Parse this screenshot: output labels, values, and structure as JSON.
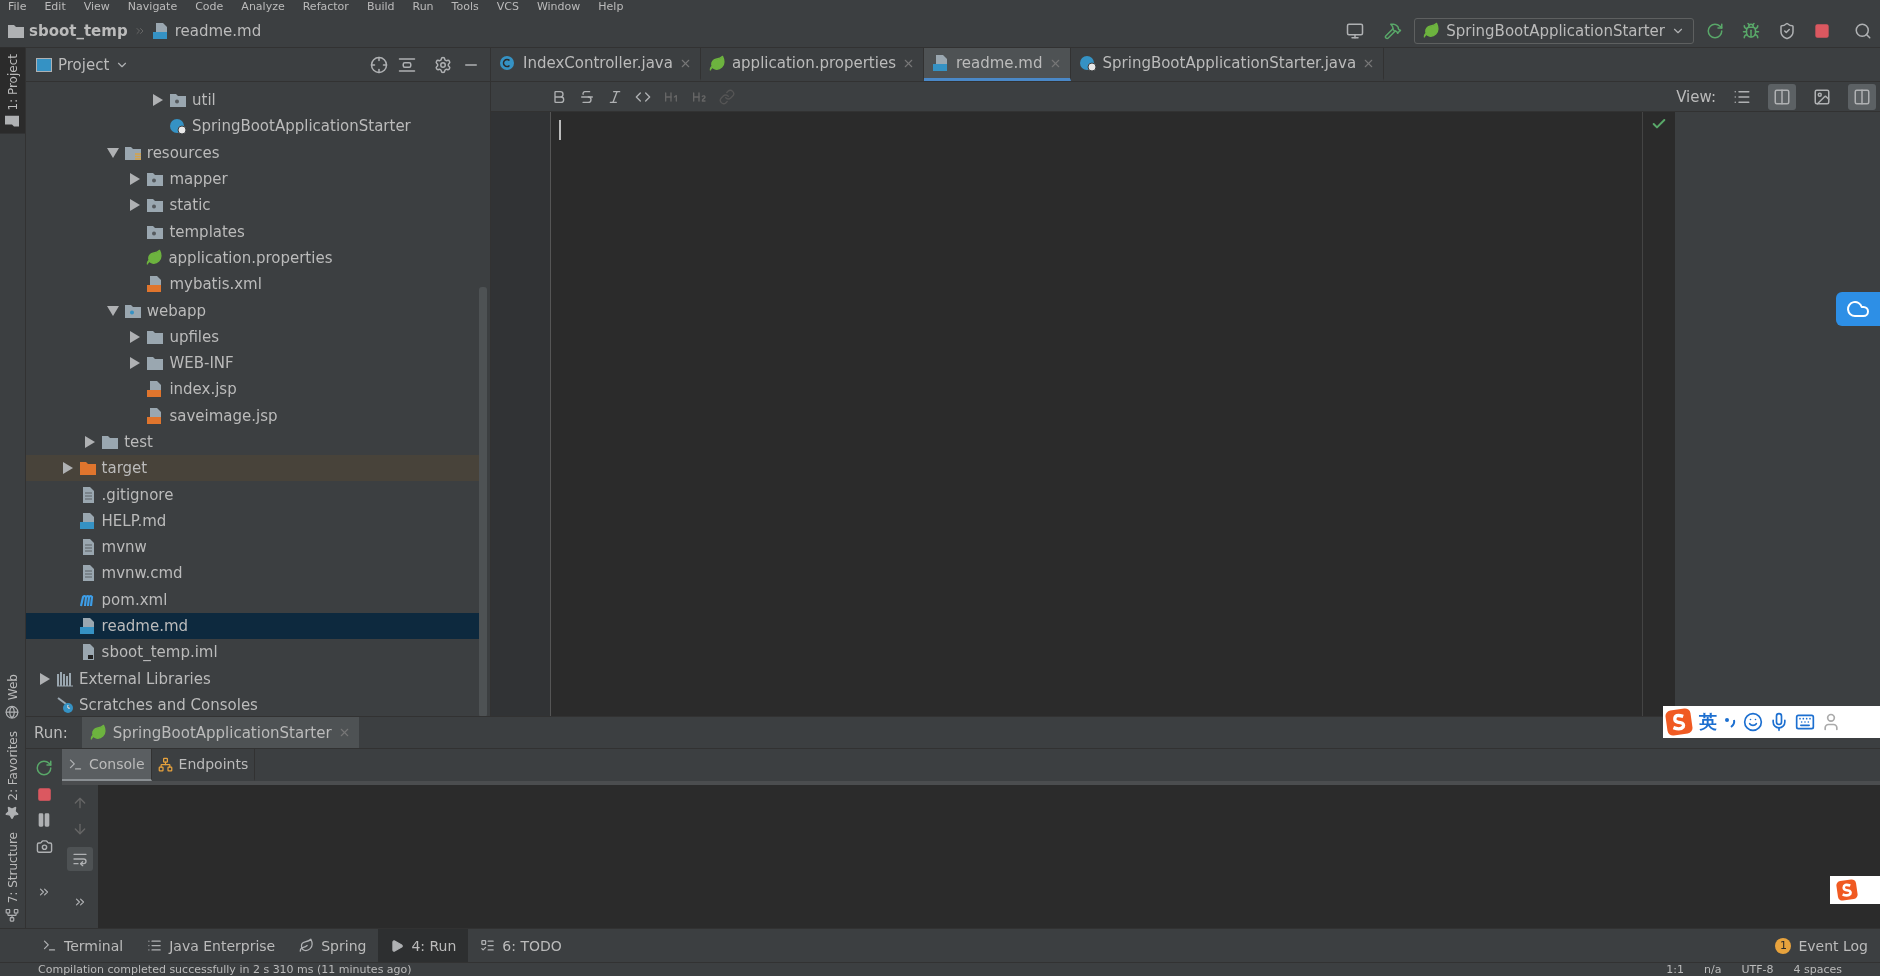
{
  "menu": [
    "File",
    "Edit",
    "View",
    "Navigate",
    "Code",
    "Analyze",
    "Refactor",
    "Build",
    "Run",
    "Tools",
    "VCS",
    "Window",
    "Help"
  ],
  "breadcrumb": [
    {
      "label": "sboot_temp",
      "kind": "project"
    },
    {
      "label": "readme.md",
      "kind": "md"
    }
  ],
  "run_config": {
    "label": "SpringBootApplicationStarter"
  },
  "side_tabs": [
    {
      "label": "1: Project",
      "selected": true,
      "kind": "project"
    },
    {
      "label": "Web",
      "selected": false,
      "kind": "web"
    },
    {
      "label": "2: Favorites",
      "selected": false,
      "kind": "favorites"
    },
    {
      "label": "7: Structure",
      "selected": false,
      "kind": "structure"
    }
  ],
  "project_panel": {
    "title": "Project"
  },
  "tree": [
    {
      "children": [
        {
          "children": [
            {
              "children": [
                {
                  "children": [
                    {
                      "children": [
                        {
                          "label": "util",
                          "kind": "package",
                          "expanded": false,
                          "selected": false
                        },
                        {
                          "label": "SpringBootApplicationStarter",
                          "kind": "spring-class",
                          "selected": false
                        }
                      ]
                    }
                  ]
                },
                {
                  "label": "resources",
                  "kind": "resource-folder",
                  "expanded": true,
                  "selected": false,
                  "children": [
                    {
                      "label": "mapper",
                      "kind": "package",
                      "expanded": false,
                      "selected": false
                    },
                    {
                      "label": "static",
                      "kind": "package",
                      "expanded": false,
                      "selected": false
                    },
                    {
                      "label": "templates",
                      "kind": "package",
                      "selected": false
                    },
                    {
                      "label": "application.properties",
                      "kind": "spring",
                      "selected": false
                    },
                    {
                      "label": "mybatis.xml",
                      "kind": "xml",
                      "selected": false
                    }
                  ]
                },
                {
                  "label": "webapp",
                  "kind": "web-folder",
                  "expanded": true,
                  "selected": false,
                  "children": [
                    {
                      "label": "upfiles",
                      "kind": "folder",
                      "expanded": false,
                      "selected": false
                    },
                    {
                      "label": "WEB-INF",
                      "kind": "folder",
                      "expanded": false,
                      "selected": false
                    },
                    {
                      "label": "index.jsp",
                      "kind": "jsp",
                      "selected": false
                    },
                    {
                      "label": "saveimage.jsp",
                      "kind": "jsp",
                      "selected": false
                    }
                  ]
                }
              ]
            },
            {
              "label": "test",
              "kind": "folder",
              "expanded": false,
              "selected": false
            }
          ]
        },
        {
          "label": "target",
          "kind": "excluded-folder",
          "expanded": false,
          "selected": false
        },
        {
          "label": ".gitignore",
          "kind": "text",
          "selected": false
        },
        {
          "label": "HELP.md",
          "kind": "md",
          "selected": false
        },
        {
          "label": "mvnw",
          "kind": "text",
          "selected": false
        },
        {
          "label": "mvnw.cmd",
          "kind": "text",
          "selected": false
        },
        {
          "label": "pom.xml",
          "kind": "maven",
          "selected": false
        },
        {
          "label": "readme.md",
          "kind": "md",
          "selected": true
        },
        {
          "label": "sboot_temp.iml",
          "kind": "iml",
          "selected": false
        }
      ]
    },
    {
      "label": "External Libraries",
      "kind": "libraries",
      "expanded": false,
      "selected": false
    },
    {
      "label": "Scratches and Consoles",
      "kind": "scratches",
      "selected": false
    }
  ],
  "editor_tabs": [
    {
      "label": "IndexController.java",
      "kind": "java-class",
      "selected": false
    },
    {
      "label": "application.properties",
      "kind": "spring",
      "selected": false
    },
    {
      "label": "readme.md",
      "kind": "md",
      "selected": true
    },
    {
      "label": "SpringBootApplicationStarter.java",
      "kind": "spring-class",
      "selected": false
    }
  ],
  "view": {
    "label": "View:",
    "modes": [
      {
        "kind": "editor",
        "selected": false
      },
      {
        "kind": "split",
        "selected": true
      },
      {
        "kind": "preview",
        "selected": false
      }
    ],
    "sync_scroll": true
  },
  "run_panel": {
    "label": "Run:",
    "tab": "SpringBootApplicationStarter",
    "tabs": [
      {
        "label": "Console",
        "kind": "console",
        "selected": true
      },
      {
        "label": "Endpoints",
        "kind": "endpoints",
        "selected": false
      }
    ]
  },
  "tool_tabs": [
    {
      "label": "Terminal",
      "kind": "terminal",
      "selected": false
    },
    {
      "label": "Java Enterprise",
      "kind": "enterprise",
      "selected": false
    },
    {
      "label": "Spring",
      "kind": "spring",
      "selected": false
    },
    {
      "label": "4: Run",
      "kind": "run",
      "selected": true
    },
    {
      "label": "6: TODO",
      "kind": "todo",
      "selected": false
    }
  ],
  "event_log": {
    "label": "Event Log",
    "count": "1"
  },
  "status_bar": {
    "message": "Compilation completed successfully in 2 s 310 ms (11 minutes ago)",
    "position": "1:1",
    "line_separator": "n/a",
    "encoding": "UTF-8",
    "indent": "4 spaces"
  },
  "ime": {
    "language": "英"
  }
}
